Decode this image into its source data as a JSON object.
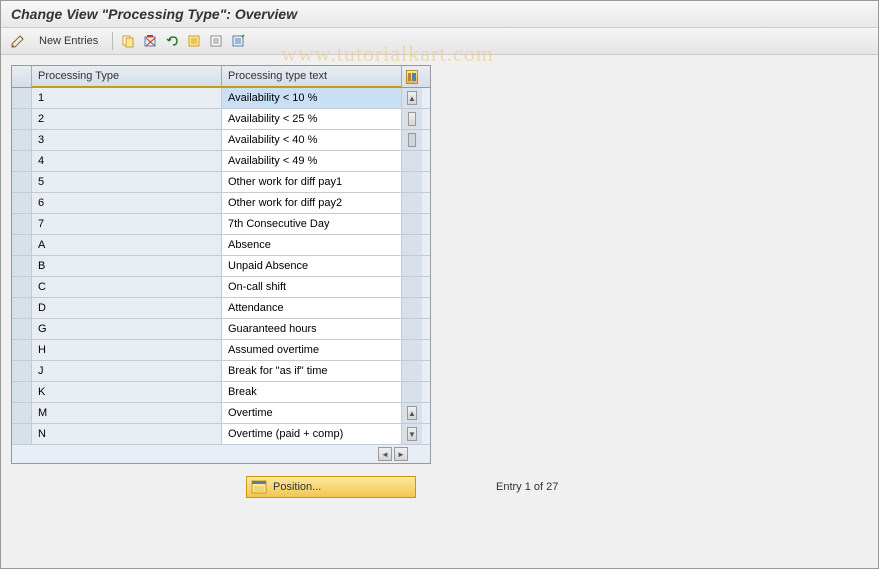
{
  "title": "Change View \"Processing Type\": Overview",
  "toolbar": {
    "new_entries_label": "New Entries"
  },
  "watermark": "www.tutorialkart.com",
  "table": {
    "headers": {
      "type": "Processing Type",
      "text": "Processing type text"
    },
    "rows": [
      {
        "type": "1",
        "text": "Availability < 10 %",
        "selected": true
      },
      {
        "type": "2",
        "text": "Availability < 25 %"
      },
      {
        "type": "3",
        "text": "Availability < 40 %"
      },
      {
        "type": "4",
        "text": "Availability < 49 %"
      },
      {
        "type": "5",
        "text": "Other work for diff pay1"
      },
      {
        "type": "6",
        "text": "Other work for diff pay2"
      },
      {
        "type": "7",
        "text": "7th Consecutive Day"
      },
      {
        "type": "A",
        "text": "Absence"
      },
      {
        "type": "B",
        "text": "Unpaid Absence"
      },
      {
        "type": "C",
        "text": "On-call shift"
      },
      {
        "type": "D",
        "text": "Attendance"
      },
      {
        "type": "G",
        "text": "Guaranteed hours"
      },
      {
        "type": "H",
        "text": "Assumed overtime"
      },
      {
        "type": "J",
        "text": "Break for \"as if\" time"
      },
      {
        "type": "K",
        "text": "Break"
      },
      {
        "type": "M",
        "text": "Overtime"
      },
      {
        "type": "N",
        "text": "Overtime (paid + comp)"
      }
    ]
  },
  "position": {
    "button_label": "Position...",
    "status": "Entry 1 of 27"
  }
}
